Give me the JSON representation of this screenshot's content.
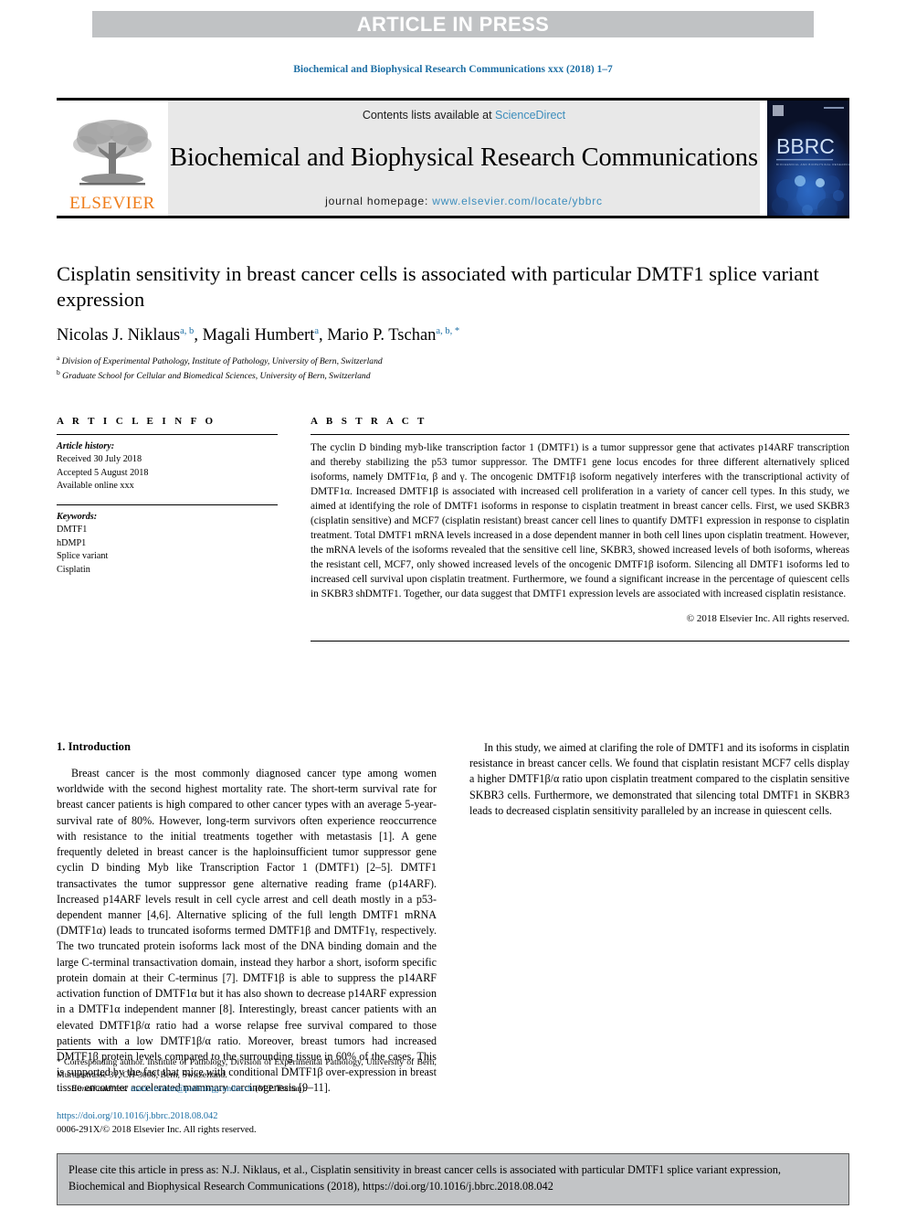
{
  "banner": {
    "text": "ARTICLE IN PRESS",
    "bg_color": "#c0c2c4",
    "text_color": "#ffffff"
  },
  "running_head": "Biochemical and Biophysical Research Communications xxx (2018) 1–7",
  "masthead": {
    "publisher_logo_label": "ELSEVIER",
    "contents_prefix": "Contents lists available at ",
    "contents_link": "ScienceDirect",
    "journal_title": "Biochemical and Biophysical Research Communications",
    "homepage_prefix": "journal homepage: ",
    "homepage_url": "www.elsevier.com/locate/ybbrc",
    "cover_label": "BBRC",
    "cover_sub": "BIOCHEMICAL AND BIOPHYSICAL RESEARCH COMMUNICATIONS",
    "link_color": "#3c8dbc",
    "band_bg": "#e8e8e8",
    "elsevier_orange": "#ef7d1a"
  },
  "article": {
    "title": "Cisplatin sensitivity in breast cancer cells is associated with particular DMTF1 splice variant expression",
    "authors": [
      {
        "name": "Nicolas J. Niklaus",
        "marks": "a, b"
      },
      {
        "name": "Magali Humbert",
        "marks": "a"
      },
      {
        "name": "Mario P. Tschan",
        "marks": "a, b, *"
      }
    ],
    "affiliations": [
      {
        "mark": "a",
        "text": "Division of Experimental Pathology, Institute of Pathology, University of Bern, Switzerland"
      },
      {
        "mark": "b",
        "text": "Graduate School for Cellular and Biomedical Sciences, University of Bern, Switzerland"
      }
    ]
  },
  "article_info": {
    "heading": "A R T I C L E   I N F O",
    "history_label": "Article history:",
    "history": [
      "Received 30 July 2018",
      "Accepted 5 August 2018",
      "Available online xxx"
    ],
    "keywords_label": "Keywords:",
    "keywords": [
      "DMTF1",
      "hDMP1",
      "Splice variant",
      "Cisplatin"
    ]
  },
  "abstract": {
    "heading": "A B S T R A C T",
    "paragraph": "The cyclin D binding myb-like transcription factor 1 (DMTF1) is a tumor suppressor gene that activates p14ARF transcription and thereby stabilizing the p53 tumor suppressor. The DMTF1 gene locus encodes for three different alternatively spliced isoforms, namely DMTF1α, β and γ. The oncogenic DMTF1β isoform negatively interferes with the transcriptional activity of DMTF1α. Increased DMTF1β is associated with increased cell proliferation in a variety of cancer cell types. In this study, we aimed at identifying the role of DMTF1 isoforms in response to cisplatin treatment in breast cancer cells. First, we used SKBR3 (cisplatin sensitive) and MCF7 (cisplatin resistant) breast cancer cell lines to quantify DMTF1 expression in response to cisplatin treatment. Total DMTF1 mRNA levels increased in a dose dependent manner in both cell lines upon cisplatin treatment. However, the mRNA levels of the isoforms revealed that the sensitive cell line, SKBR3, showed increased levels of both isoforms, whereas the resistant cell, MCF7, only showed increased levels of the oncogenic DMTF1β isoform. Silencing all DMTF1 isoforms led to increased cell survival upon cisplatin treatment. Furthermore, we found a significant increase in the percentage of quiescent cells in SKBR3 shDMTF1. Together, our data suggest that DMTF1 expression levels are associated with increased cisplatin resistance.",
    "copyright": "© 2018 Elsevier Inc. All rights reserved."
  },
  "introduction": {
    "heading": "1. Introduction",
    "paragraph_1": "Breast cancer is the most commonly diagnosed cancer type among women worldwide with the second highest mortality rate. The short-term survival rate for breast cancer patients is high compared to other cancer types with an average 5-year-survival rate of 80%. However, long-term survivors often experience reoccurrence with resistance to the initial treatments together with metastasis [1]. A gene frequently deleted in breast cancer is the haploinsufficient tumor suppressor gene cyclin D binding Myb like Transcription Factor 1 (DMTF1) [2–5]. DMTF1 transactivates the tumor suppressor gene alternative reading frame (p14ARF). Increased p14ARF levels result in cell cycle arrest and cell death mostly in a p53-dependent manner [4,6]. Alternative splicing of the full length DMTF1 mRNA (DMTF1α) leads to truncated isoforms termed DMTF1β and DMTF1γ, respectively. The two truncated protein isoforms lack most of the DNA binding domain and the large C-terminal transactivation domain, instead they harbor a short, isoform specific protein domain at their C-terminus [7]. DMTF1β is able to suppress the p14ARF activation function of DMTF1α but it has also shown to decrease p14ARF expression in a DMTF1α independent manner [8]. Interestingly, breast cancer patients with an elevated DMTF1β/α ratio had a worse relapse free survival compared to those patients with a low DMTF1β/α ratio. Moreover, breast tumors had increased DMTF1β protein levels compared to the surrounding tissue in 60% of the cases. This is supported by the fact that mice with conditional DMTF1β over-expression in breast tissue encounter accelerated mammary carcinogenesis [9–11].",
    "paragraph_2": "In this study, we aimed at clarifing the role of DMTF1 and its isoforms in cisplatin resistance in breast cancer cells. We found that cisplatin resistant MCF7 cells display a higher DMTF1β/α ratio upon cisplatin treatment compared to the cisplatin sensitive SKBR3 cells. Furthermore, we demonstrated that silencing total DMTF1 in SKBR3 leads to decreased cisplatin sensitivity paralleled by an increase in quiescent cells."
  },
  "footnote": {
    "corresponding_marker": "*",
    "corresponding_text": "Corresponding author. Institute of Pathology, Division of Experimental Pathology, University of Bern, Murtenstrasse 31, CH-3008, Bern, Switzerland.",
    "email_label": "E-mail address:",
    "email": "mario.tschan@pathology.unibe.ch",
    "email_owner": "(M.P. Tschan).",
    "doi": "https://doi.org/10.1016/j.bbrc.2018.08.042",
    "issn_line": "0006-291X/© 2018 Elsevier Inc. All rights reserved."
  },
  "cite_box": {
    "text": "Please cite this article in press as: N.J. Niklaus, et al., Cisplatin sensitivity in breast cancer cells is associated with particular DMTF1 splice variant expression, Biochemical and Biophysical Research Communications (2018), https://doi.org/10.1016/j.bbrc.2018.08.042",
    "bg_color": "#c2c4c6"
  }
}
